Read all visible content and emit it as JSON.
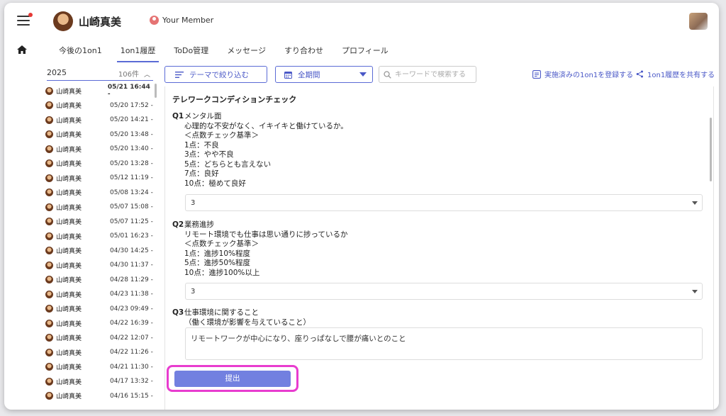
{
  "header": {
    "user_name": "山崎真美",
    "member_label": "Your Member"
  },
  "tabs": [
    {
      "label": "今後の1on1"
    },
    {
      "label": "1on1履歴"
    },
    {
      "label": "ToDo管理"
    },
    {
      "label": "メッセージ"
    },
    {
      "label": "すり合わせ"
    },
    {
      "label": "プロフィール"
    }
  ],
  "toolbar": {
    "year": "2025",
    "count": "106件",
    "filter_label": "テーマで絞り込む",
    "period_label": "全期間",
    "search_placeholder": "キーワードで検索する",
    "register_label": "実施済みの1on1を登録する",
    "share_label": "1on1履歴を共有する"
  },
  "history": [
    {
      "name": "山崎真美",
      "date": "05/21 16:44 -"
    },
    {
      "name": "山崎真美",
      "date": "05/20 17:52 -"
    },
    {
      "name": "山崎真美",
      "date": "05/20 14:21 -"
    },
    {
      "name": "山崎真美",
      "date": "05/20 13:48 -"
    },
    {
      "name": "山崎真美",
      "date": "05/20 13:40 -"
    },
    {
      "name": "山崎真美",
      "date": "05/20 13:28 -"
    },
    {
      "name": "山崎真美",
      "date": "05/12 11:19 -"
    },
    {
      "name": "山崎真美",
      "date": "05/08 13:24 -"
    },
    {
      "name": "山崎真美",
      "date": "05/07 15:08 -"
    },
    {
      "name": "山崎真美",
      "date": "05/07 11:25 -"
    },
    {
      "name": "山崎真美",
      "date": "05/01 16:23 -"
    },
    {
      "name": "山崎真美",
      "date": "04/30 14:25 -"
    },
    {
      "name": "山崎真美",
      "date": "04/30 11:37 -"
    },
    {
      "name": "山崎真美",
      "date": "04/28 11:29 -"
    },
    {
      "name": "山崎真美",
      "date": "04/23 11:38 -"
    },
    {
      "name": "山崎真美",
      "date": "04/23 09:49 -"
    },
    {
      "name": "山崎真美",
      "date": "04/22 16:39 -"
    },
    {
      "name": "山崎真美",
      "date": "04/22 12:07 -"
    },
    {
      "name": "山崎真美",
      "date": "04/22 11:26 -"
    },
    {
      "name": "山崎真美",
      "date": "04/21 11:30 -"
    },
    {
      "name": "山崎真美",
      "date": "04/17 13:32 -"
    },
    {
      "name": "山崎真美",
      "date": "04/16 15:15 -"
    }
  ],
  "content": {
    "title": "テレワークコンディションチェック",
    "q1": {
      "number": "Q1",
      "heading": "メンタル面",
      "lines": [
        "心理的な不安がなく、イキイキと働けているか。",
        "＜点数チェック基準＞",
        "1点：不良",
        "3点：やや不良",
        "5点：どちらとも言えない",
        "7点：良好",
        "10点：極めて良好"
      ],
      "value": "3"
    },
    "q2": {
      "number": "Q2",
      "heading": "業務進捗",
      "lines": [
        "リモート環境でも仕事は思い通りに捗っているか",
        "＜点数チェック基準＞",
        "1点：進捗10%程度",
        "5点：進捗50%程度",
        "10点：進捗100%以上"
      ],
      "value": "3"
    },
    "q3": {
      "number": "Q3",
      "heading": "仕事環境に関すること",
      "lines": [
        "（働く環境が影響を与えていること）"
      ],
      "answer": "リモートワークが中心になり、座りっぱなしで腰が痛いとのこと"
    },
    "submit_label": "提出"
  },
  "colors": {
    "accent": "#5b6bd6",
    "submit_bg": "#7280e0",
    "highlight": "#e83ccf"
  }
}
